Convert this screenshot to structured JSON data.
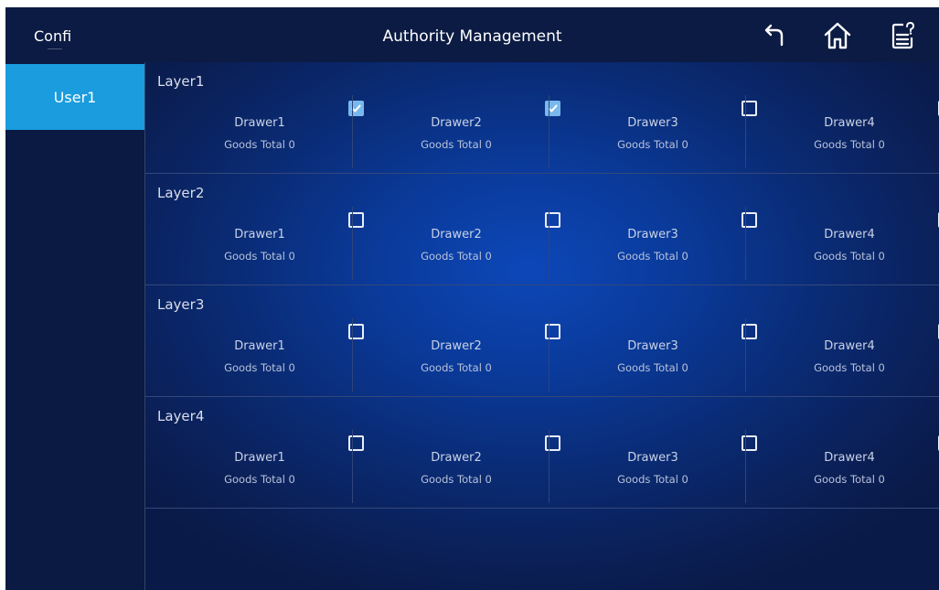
{
  "topbar": {
    "app_title": "Confi",
    "page_title": "Authority Management",
    "back_icon": "back-arrow-icon",
    "home_icon": "home-icon",
    "help_icon": "help-document-icon"
  },
  "sidebar": {
    "users": [
      {
        "label": "User1",
        "selected": true
      }
    ]
  },
  "layers": [
    {
      "title": "Layer1",
      "drawers": [
        {
          "name": "Drawer1",
          "goods": "Goods Total 0",
          "checked": true
        },
        {
          "name": "Drawer2",
          "goods": "Goods Total 0",
          "checked": true
        },
        {
          "name": "Drawer3",
          "goods": "Goods Total 0",
          "checked": false
        },
        {
          "name": "Drawer4",
          "goods": "Goods Total 0",
          "checked": false
        }
      ]
    },
    {
      "title": "Layer2",
      "drawers": [
        {
          "name": "Drawer1",
          "goods": "Goods Total 0",
          "checked": false
        },
        {
          "name": "Drawer2",
          "goods": "Goods Total 0",
          "checked": false
        },
        {
          "name": "Drawer3",
          "goods": "Goods Total 0",
          "checked": false
        },
        {
          "name": "Drawer4",
          "goods": "Goods Total 0",
          "checked": false
        }
      ]
    },
    {
      "title": "Layer3",
      "drawers": [
        {
          "name": "Drawer1",
          "goods": "Goods Total 0",
          "checked": false
        },
        {
          "name": "Drawer2",
          "goods": "Goods Total 0",
          "checked": false
        },
        {
          "name": "Drawer3",
          "goods": "Goods Total 0",
          "checked": false
        },
        {
          "name": "Drawer4",
          "goods": "Goods Total 0",
          "checked": false
        }
      ]
    },
    {
      "title": "Layer4",
      "drawers": [
        {
          "name": "Drawer1",
          "goods": "Goods Total 0",
          "checked": false
        },
        {
          "name": "Drawer2",
          "goods": "Goods Total 0",
          "checked": false
        },
        {
          "name": "Drawer3",
          "goods": "Goods Total 0",
          "checked": false
        },
        {
          "name": "Drawer4",
          "goods": "Goods Total 0",
          "checked": false
        }
      ]
    }
  ],
  "colors": {
    "topbar_bg": "#0b1b43",
    "sidebar_bg": "#0a1a43",
    "selected_user_bg": "#1a9cde",
    "checkbox_checked": "#79b8ec",
    "main_glow": "#0d47b8"
  }
}
